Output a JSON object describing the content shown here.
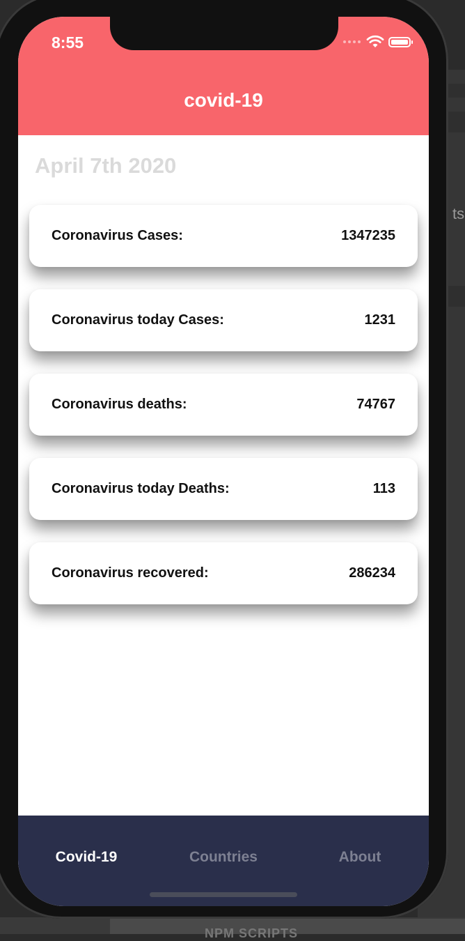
{
  "status_bar": {
    "time": "8:55"
  },
  "navigation": {
    "title": "covid-19"
  },
  "date": "April 7th 2020",
  "stats": [
    {
      "label": "Coronavirus Cases:",
      "value": "1347235"
    },
    {
      "label": "Coronavirus today Cases:",
      "value": "1231"
    },
    {
      "label": "Coronavirus deaths:",
      "value": "74767"
    },
    {
      "label": "Coronavirus today Deaths:",
      "value": "113"
    },
    {
      "label": "Coronavirus recovered:",
      "value": "286234"
    }
  ],
  "tabs": [
    {
      "label": "Covid-19",
      "active": true
    },
    {
      "label": "Countries",
      "active": false
    },
    {
      "label": "About",
      "active": false
    }
  ],
  "background": {
    "side_text": "ts",
    "bottom_text": "NPM SCRIPTS"
  },
  "colors": {
    "header": "#f8656b",
    "tabbar": "#2a2f4b",
    "tab_inactive": "#7d8092",
    "date_text": "#dadada"
  }
}
